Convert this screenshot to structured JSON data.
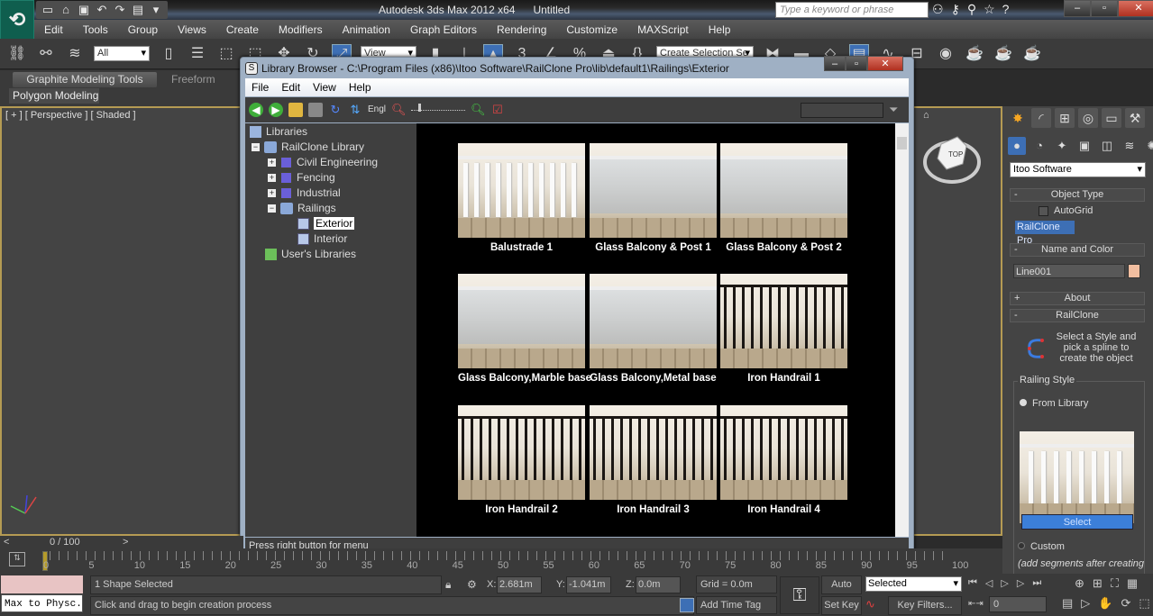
{
  "app": {
    "title": "Autodesk 3ds Max 2012 x64",
    "document": "Untitled",
    "search_placeholder": "Type a keyword or phrase",
    "menu": [
      "Edit",
      "Tools",
      "Group",
      "Views",
      "Create",
      "Modifiers",
      "Animation",
      "Graph Editors",
      "Rendering",
      "Customize",
      "MAXScript",
      "Help"
    ]
  },
  "toolbar": {
    "selection_filter": "All",
    "reference_coord": "View",
    "named_selection": "Create Selection Se",
    "snap_label": "3"
  },
  "ribbon": {
    "tabs": [
      "Graphite Modeling Tools",
      "Freeform"
    ],
    "panel": "Polygon Modeling"
  },
  "viewport": {
    "label": "[ + ] [ Perspective ] [ Shaded ]",
    "viewcube_face": "TOP"
  },
  "library_browser": {
    "title": "Library Browser - C:\\Program Files (x86)\\Itoo Software\\RailClone Pro\\lib\\default1\\Railings\\Exterior",
    "menu": [
      "File",
      "Edit",
      "View",
      "Help"
    ],
    "toolbar_lang": "Engl",
    "tree": {
      "root": "Libraries",
      "library": "RailClone Library",
      "categories": [
        "Civil Engineering",
        "Fencing",
        "Industrial"
      ],
      "expanded": "Railings",
      "children": [
        "Exterior",
        "Interior"
      ],
      "selected": "Exterior",
      "user": "User's Libraries"
    },
    "items": [
      {
        "name": "Balustrade 1",
        "style": "white"
      },
      {
        "name": "Glass Balcony & Post 1",
        "style": "glass"
      },
      {
        "name": "Glass Balcony & Post 2",
        "style": "glass"
      },
      {
        "name": "Glass Balcony,Marble base",
        "style": "glass"
      },
      {
        "name": "Glass Balcony,Metal base",
        "style": "glass"
      },
      {
        "name": "Iron Handrail 1",
        "style": "iron"
      },
      {
        "name": "Iron Handrail 2",
        "style": "iron"
      },
      {
        "name": "Iron Handrail 3",
        "style": "iron"
      },
      {
        "name": "Iron Handrail 4",
        "style": "iron"
      }
    ],
    "status": "Press right button for menu"
  },
  "command_panel": {
    "category_dropdown": "Itoo Software",
    "object_type_header": "Object Type",
    "autogrid_label": "AutoGrid",
    "object_button": "RailClone Pro",
    "name_color_header": "Name and Color",
    "object_name": "Line001",
    "object_color": "#f2bea0",
    "about_header": "About",
    "railclone_header": "RailClone",
    "description": "Select a Style and pick a spline to create the object",
    "railing_style_label": "Railing Style",
    "from_library_label": "From Library",
    "select_button": "Select",
    "custom_label": "Custom",
    "custom_note": "(add segments after creating"
  },
  "timeline": {
    "frame_display": "0 / 100",
    "prev": "<",
    "next": ">",
    "ticks": [
      "0",
      "5",
      "10",
      "15",
      "20",
      "25",
      "30",
      "35",
      "40",
      "45",
      "50",
      "55",
      "60",
      "65",
      "70",
      "75",
      "80",
      "85",
      "90",
      "95",
      "100"
    ]
  },
  "status": {
    "script_listener": "Max to Physc.",
    "selection": "1 Shape Selected",
    "prompt": "Click and drag to begin creation process",
    "x": "2.681m",
    "y": "-1.041m",
    "z": "0.0m",
    "grid": "Grid = 0.0m",
    "add_time_tag": "Add Time Tag",
    "auto_key": "Auto Key",
    "set_key": "Set Key",
    "key_mode": "Selected",
    "key_filters": "Key Filters...",
    "current_frame": "0"
  }
}
